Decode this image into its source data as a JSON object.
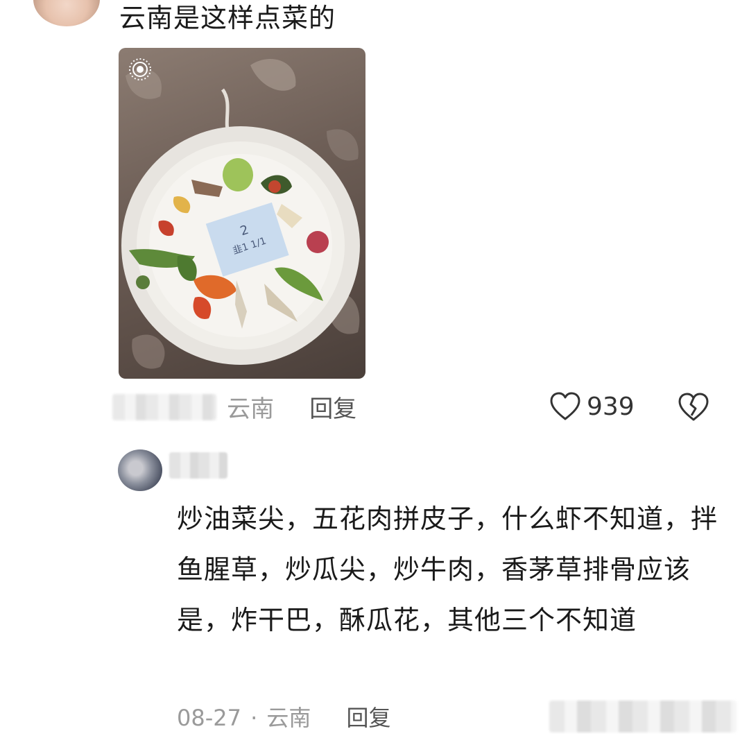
{
  "top_comment": {
    "text": "云南是这样点菜的",
    "location": "云南",
    "reply_label": "回复",
    "likes": "939",
    "photo_card_text": "2 韭1 1/1"
  },
  "reply_comment": {
    "text": "炒油菜尖，五花肉拼皮子，什么虾不知道，拌鱼腥草，炒瓜尖，炒牛肉，香茅草排骨应该是，炸干巴，酥瓜花，其他三个不知道",
    "date": "08-27",
    "separator": "·",
    "location": "云南",
    "reply_label": "回复"
  },
  "icons": {
    "like": "heart-outline-icon",
    "dislike": "broken-heart-icon",
    "live_photo": "live-photo-icon"
  }
}
